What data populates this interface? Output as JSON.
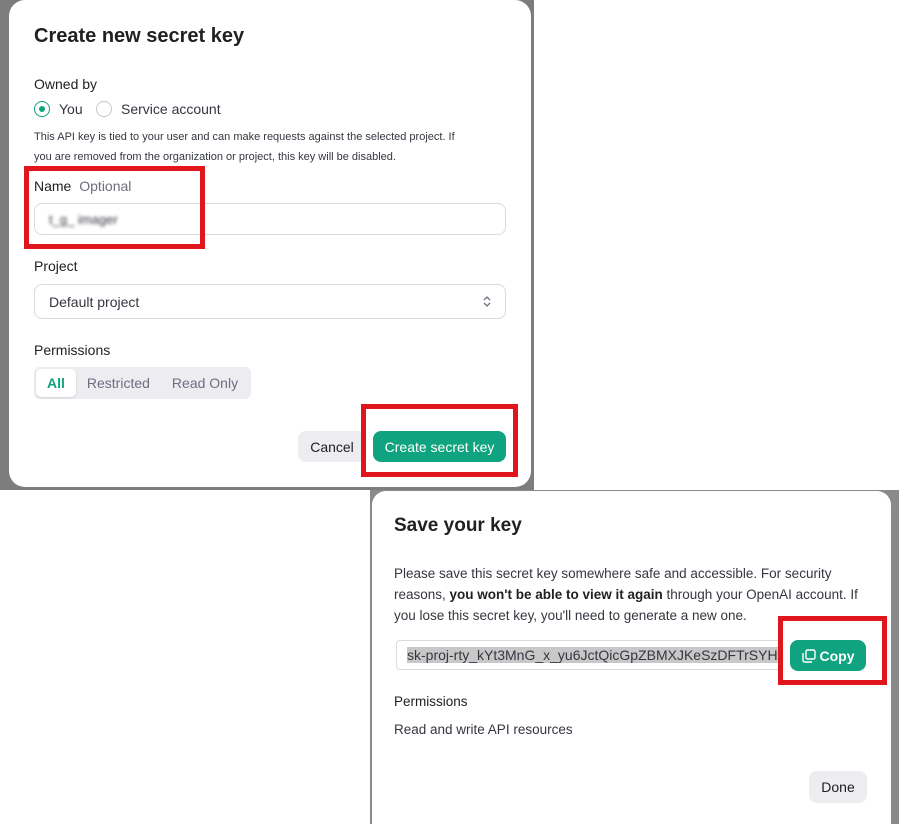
{
  "create_dialog": {
    "title": "Create new secret key",
    "owned_by_label": "Owned by",
    "owner_options": [
      {
        "label": "You",
        "selected": true
      },
      {
        "label": "Service account",
        "selected": false
      }
    ],
    "owner_note_line1": "This API key is tied to your user and can make requests against the selected project. If",
    "owner_note_line2": "you are removed from the organization or project, this key will be disabled.",
    "name_label": "Name",
    "name_optional": "Optional",
    "name_value": "t_g_ imager",
    "project_label": "Project",
    "project_value": "Default project",
    "permissions_label": "Permissions",
    "permission_options": [
      {
        "label": "All",
        "active": true
      },
      {
        "label": "Restricted",
        "active": false
      },
      {
        "label": "Read Only",
        "active": false
      }
    ],
    "cancel_label": "Cancel",
    "create_label": "Create secret key"
  },
  "save_dialog": {
    "title": "Save your key",
    "desc_part1": "Please save this secret key somewhere safe and accessible. For security reasons, ",
    "desc_bold": "you won't be able to view it again",
    "desc_part2": " through your OpenAI account. If you lose this secret key, you'll need to generate a new one.",
    "secret_key": "sk-proj-rty_kYt3MnG_x_yu6JctQicGpZBMXJKeSzDFTrSYH",
    "copy_label": "Copy",
    "permissions_label": "Permissions",
    "permissions_value": "Read and write API resources",
    "done_label": "Done"
  },
  "colors": {
    "accent": "#10a37f",
    "highlight_box": "#e0161c",
    "overlay": "#7d7d7d"
  },
  "icons": {
    "copy": "copy-icon",
    "select": "chevron-up-down-icon"
  }
}
